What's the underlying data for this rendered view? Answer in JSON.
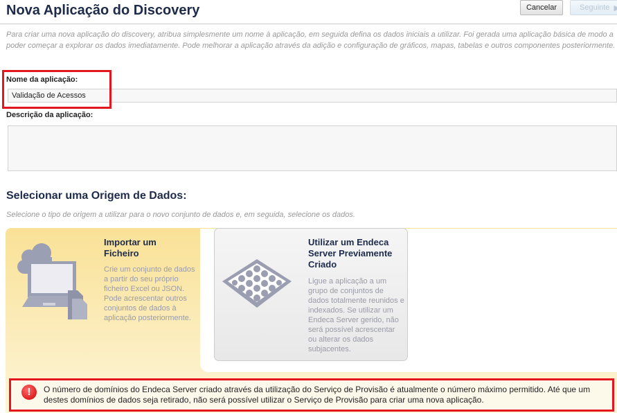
{
  "header": {
    "title": "Nova Aplicação do Discovery",
    "cancel_label": "Cancelar",
    "next_label": "Seguinte"
  },
  "intro": "Para criar uma nova aplicação do discovery, atribua simplesmente um nome à aplicação, em seguida defina os dados iniciais a utilizar. Foi gerada uma aplicação básica de modo a poder começar a explorar os dados imediatamente. Pode melhorar a aplicação através da adição e configuração de gráficos, mapas, tabelas e outros componentes posteriormente.",
  "form": {
    "name_label": "Nome da aplicação:",
    "name_value": "Validação de Acessos",
    "desc_label": "Descrição da aplicação:",
    "desc_value": ""
  },
  "datasource": {
    "heading": "Selecionar uma Origem de Dados:",
    "subtitle": "Selecione o tipo de origem a utilizar para o novo conjunto de dados e, em seguida, selecione os dados.",
    "options": [
      {
        "title": "Importar um Ficheiro",
        "description": "Crie um conjunto de dados a partir do seu próprio ficheiro Excel ou JSON. Pode acrescentar outros conjuntos de dados à aplicação posteriormente.",
        "icon": "laptop-cloud-file-icon",
        "selected": true
      },
      {
        "title": "Utilizar um Endeca Server Previamente Criado",
        "description": "Ligue a aplicação a um grupo de conjuntos de dados totalmente reunidos e indexados. Se utilizar um Endeca Server gerido, não será possível acrescentar ou alterar os dados subjacentes.",
        "icon": "grid-server-icon",
        "selected": false
      }
    ]
  },
  "alert": {
    "icon": "error-icon",
    "text": "O número de domínios do Endeca Server criado através da utilização do Serviço de Provisão é atualmente o número máximo permitido. Até que um destes domínios de dados seja retirado, não será possível utilizar o Serviço de Provisão para criar uma nova aplicação."
  },
  "colors": {
    "highlight": "#e3161f",
    "selected_card": "#f9e196",
    "title": "#1d2a4a"
  }
}
